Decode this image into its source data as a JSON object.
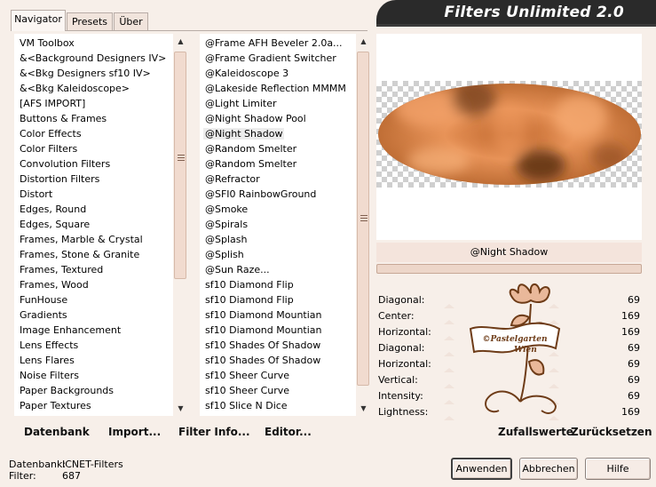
{
  "app": {
    "title": "Filters Unlimited 2.0"
  },
  "tabs": [
    {
      "label": "Navigator"
    },
    {
      "label": "Presets"
    },
    {
      "label": "Über"
    }
  ],
  "categories": [
    {
      "label": "VM Toolbox"
    },
    {
      "label": "&<Background Designers IV>"
    },
    {
      "label": "&<Bkg Designers sf10 IV>"
    },
    {
      "label": "&<Bkg Kaleidoscope>"
    },
    {
      "label": "[AFS IMPORT]"
    },
    {
      "label": "Buttons & Frames"
    },
    {
      "label": "Color Effects"
    },
    {
      "label": "Color Filters"
    },
    {
      "label": "Convolution Filters"
    },
    {
      "label": "Distortion Filters"
    },
    {
      "label": "Distort"
    },
    {
      "label": "Edges, Round"
    },
    {
      "label": "Edges, Square"
    },
    {
      "label": "Frames, Marble & Crystal"
    },
    {
      "label": "Frames, Stone & Granite"
    },
    {
      "label": "Frames, Textured"
    },
    {
      "label": "Frames, Wood"
    },
    {
      "label": "FunHouse"
    },
    {
      "label": "Gradients"
    },
    {
      "label": "Image Enhancement"
    },
    {
      "label": "Lens Effects"
    },
    {
      "label": "Lens Flares"
    },
    {
      "label": "Noise Filters"
    },
    {
      "label": "Paper Backgrounds"
    },
    {
      "label": "Paper Textures"
    }
  ],
  "filters": [
    {
      "label": "@Frame AFH Beveler 2.0a..."
    },
    {
      "label": "@Frame Gradient Switcher"
    },
    {
      "label": "@Kaleidoscope 3"
    },
    {
      "label": "@Lakeside Reflection MMMM"
    },
    {
      "label": "@Light Limiter"
    },
    {
      "label": "@Night Shadow Pool"
    },
    {
      "label": "@Night Shadow"
    },
    {
      "label": "@Random Smelter"
    },
    {
      "label": "@Random Smelter"
    },
    {
      "label": "@Refractor"
    },
    {
      "label": "@SFI0 RainbowGround"
    },
    {
      "label": "@Smoke"
    },
    {
      "label": "@Spirals"
    },
    {
      "label": "@Splash"
    },
    {
      "label": "@Splish"
    },
    {
      "label": "@Sun Raze..."
    },
    {
      "label": "sf10 Diamond Flip"
    },
    {
      "label": "sf10 Diamond Flip"
    },
    {
      "label": "sf10 Diamond Mountian"
    },
    {
      "label": "sf10 Diamond Mountian"
    },
    {
      "label": "sf10 Shades Of Shadow"
    },
    {
      "label": "sf10 Shades Of Shadow"
    },
    {
      "label": "sf10 Sheer Curve"
    },
    {
      "label": "sf10 Sheer Curve"
    },
    {
      "label": "sf10 Slice N Dice"
    }
  ],
  "bottom_links": {
    "database": "Datenbank",
    "import": "Import...",
    "filter_info": "Filter Info...",
    "editor": "Editor..."
  },
  "preview": {
    "filter_name": "@Night Shadow",
    "accent_orange": "#e08a4f",
    "dark_brown": "#6e3c18"
  },
  "params": [
    {
      "label": "Diagonal:",
      "value": "69"
    },
    {
      "label": "Center:",
      "value": "169"
    },
    {
      "label": "Horizontal:",
      "value": "169"
    },
    {
      "label": "Diagonal:",
      "value": "69"
    },
    {
      "label": "Horizontal:",
      "value": "69"
    },
    {
      "label": "Vertical:",
      "value": "69"
    },
    {
      "label": "Intensity:",
      "value": "69"
    },
    {
      "label": "Lightness:",
      "value": "169"
    }
  ],
  "param_actions": {
    "randomize": "Zufallswerte",
    "reset": "Zurücksetzen"
  },
  "watermark": {
    "line1": "©Pastelgarten",
    "line2": "Wien"
  },
  "status": {
    "database_label": "Datenbank:",
    "database_value": "ICNET-Filters",
    "filter_label": "Filter:",
    "filter_value": "687"
  },
  "buttons": {
    "apply": "Anwenden",
    "cancel": "Abbrechen",
    "help": "Hilfe"
  }
}
